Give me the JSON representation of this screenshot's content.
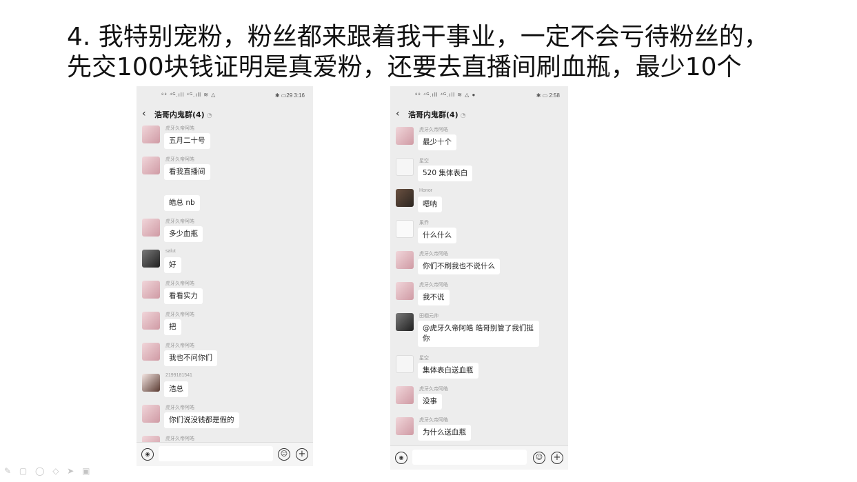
{
  "title": {
    "line1": "4. 我特别宠粉，粉丝都来跟着我干事业，一定不会亏待粉丝的，",
    "line2": "先交100块钱证明是真爱粉，还要去直播间刷血瓶，最少10个"
  },
  "left_phone": {
    "status_left": "⁸⁸ ⁴ᴳ.ıll ⁴ᴳ.ıll ≋ △",
    "status_right": "✱ ▭29 3:16",
    "chat_title": "浩哥内鬼群(4)",
    "messages": [
      {
        "sender": "虎牙久帝阿皓",
        "text": "五月二十号"
      },
      {
        "sender": "虎牙久帝阿皓",
        "text": "看我直播间"
      },
      {
        "sender": "",
        "text": "皓总 nb"
      },
      {
        "sender": "虎牙久帝阿皓",
        "text": "多少血瓶"
      },
      {
        "sender": "salut",
        "text": "好"
      },
      {
        "sender": "虎牙久帝阿皓",
        "text": "看看实力"
      },
      {
        "sender": "虎牙久帝阿皓",
        "text": "把"
      },
      {
        "sender": "虎牙久帝阿皓",
        "text": "我也不问你们"
      },
      {
        "sender": "2199181541",
        "text": "浩总"
      },
      {
        "sender": "虎牙久帝阿皓",
        "text": "你们说没钱都是假的"
      },
      {
        "sender": "虎牙久帝阿皓",
        "text": ""
      }
    ]
  },
  "right_phone": {
    "status_left": "⁸⁸ ⁴ᴳ.ıll ⁴ᴳ.ıll ≋ △ ●",
    "status_right": "✱ ▭ 2:58",
    "chat_title": "浩哥内鬼群(4)",
    "messages": [
      {
        "sender": "虎牙久帝阿皓",
        "text": "最少十个"
      },
      {
        "sender": "星空",
        "text": "520 集体表白"
      },
      {
        "sender": "Honor",
        "text": "嗯呐"
      },
      {
        "sender": "果乔",
        "text": "什么什么"
      },
      {
        "sender": "虎牙久帝阿皓",
        "text": "你们不刷我也不说什么"
      },
      {
        "sender": "虎牙久帝阿皓",
        "text": "我不说"
      },
      {
        "sender": "田棚元帅",
        "text": "@虎牙久帝阿皓  皓哥别管了我们挺你"
      },
      {
        "sender": "星空",
        "text": "集体表白送血瓶"
      },
      {
        "sender": "虎牙久帝阿皓",
        "text": "没事"
      },
      {
        "sender": "虎牙久帝阿皓",
        "text": "为什么送血瓶"
      }
    ]
  },
  "icons": {
    "back": "‹",
    "mute": "◔",
    "voice": "◉",
    "emoji": "☺",
    "plus": "+",
    "toolbar": "✎ ▢ ◯ ◇ ➤ ▣"
  }
}
